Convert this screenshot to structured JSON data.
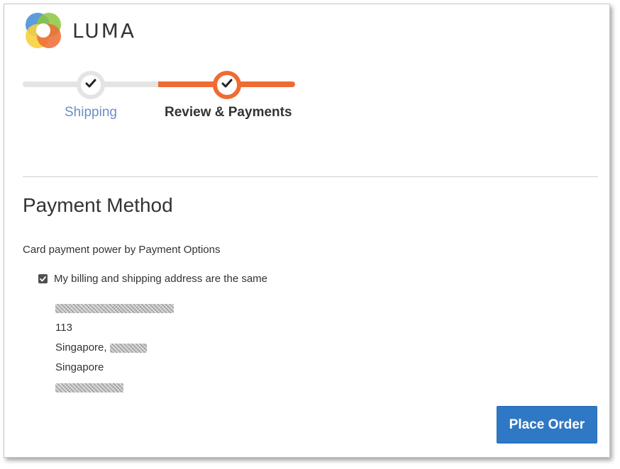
{
  "brand": {
    "name": "LUMA",
    "logo_icon": "luma-logo-icon",
    "colors": [
      "#4a90d9",
      "#8cc63f",
      "#f7d23e",
      "#ef6b34"
    ]
  },
  "progress": {
    "steps": [
      {
        "label": "Shipping",
        "state": "complete"
      },
      {
        "label": "Review & Payments",
        "state": "active"
      }
    ],
    "active_color": "#ef6b34",
    "inactive_color": "#e4e4e4"
  },
  "payment": {
    "title": "Payment Method",
    "description": "Card payment power by Payment Options",
    "billing_same_label": "My billing and shipping address are the same",
    "billing_same_checked": true
  },
  "address": {
    "line_unit": "113",
    "city_prefix": "Singapore,",
    "country": "Singapore"
  },
  "actions": {
    "place_order_label": "Place Order",
    "place_order_color": "#2f78c5"
  }
}
